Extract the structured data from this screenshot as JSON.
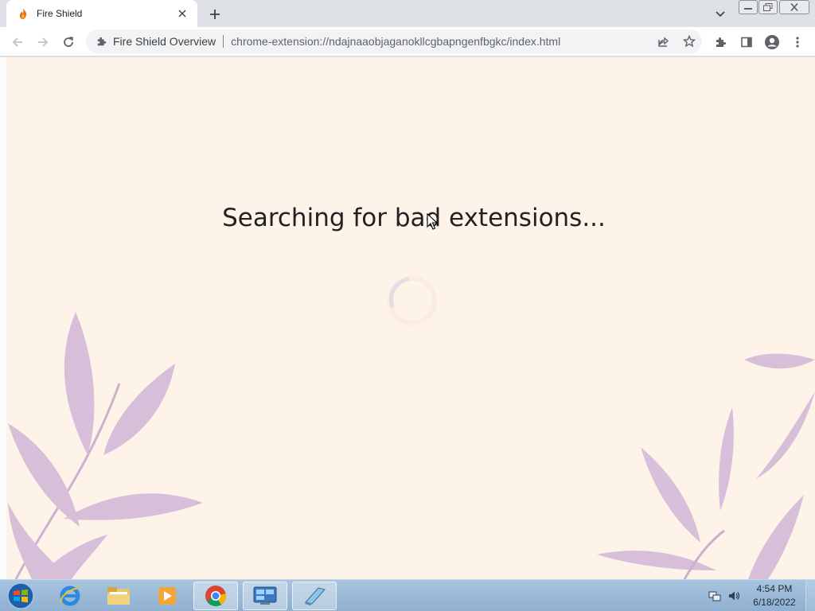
{
  "browser": {
    "tab": {
      "title": "Fire Shield",
      "favicon": "flame-icon"
    },
    "omnibox": {
      "site_label": "Fire Shield Overview",
      "url": "chrome-extension://ndajnaaobjaganokllcgbapngenfbgkc/index.html"
    }
  },
  "page": {
    "heading": "Searching for bad extensions...",
    "background_color": "#fef3e8",
    "leaf_color": "#d9bddd"
  },
  "taskbar": {
    "pinned": [
      "ie-icon",
      "explorer-icon",
      "media-player-icon",
      "chrome-icon",
      "control-panel-icon",
      "notepad-icon"
    ],
    "clock": {
      "time": "4:54 PM",
      "date": "6/18/2022"
    }
  }
}
